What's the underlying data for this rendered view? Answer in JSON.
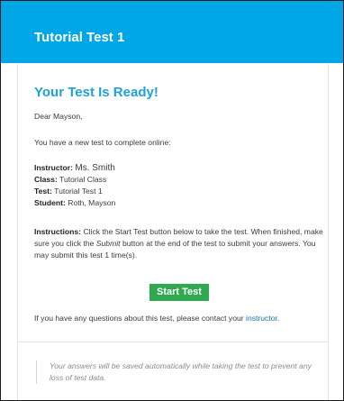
{
  "header": {
    "title": "Tutorial Test 1"
  },
  "email": {
    "heading": "Your Test Is Ready!",
    "greeting": "Dear Mayson,",
    "intro": "You have a new test to complete online:",
    "details": {
      "instructor_label": "Instructor:",
      "instructor_value": "Ms. Smith",
      "class_label": "Class:",
      "class_value": "Tutorial Class",
      "test_label": "Test:",
      "test_value": "Tutorial Test 1",
      "student_label": "Student:",
      "student_value": "Roth, Mayson"
    },
    "instructions": {
      "label": "Instructions:",
      "text_1": "Click the Start Test button below to take the test. When finished, make sure you click the",
      "emphasis": "Submit",
      "text_2": "button at the end of the test to submit your answers. You may submit this test 1 time(s)."
    },
    "start_button_label": "Start Test",
    "contact_text": "If you have any questions about this test, please contact your",
    "contact_link": "instructor",
    "contact_end": ".",
    "footer_note": "Your answers will be saved automatically while taking the test to prevent any loss of test data."
  },
  "colors": {
    "header_bg": "#00a7e6",
    "heading": "#1ea0d8",
    "button_bg": "#2fa84f",
    "link": "#1a6fa8"
  }
}
